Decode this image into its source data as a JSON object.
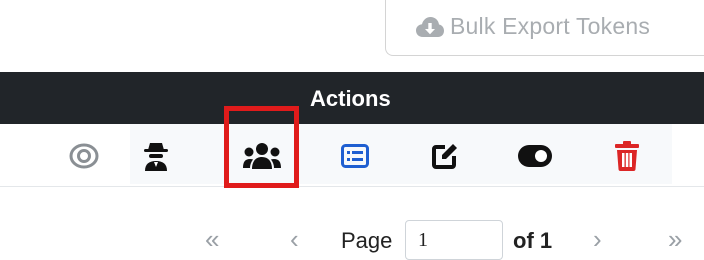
{
  "toolbar": {
    "bulk_export_label": "Bulk Export Tokens",
    "bulk_export_icon": "cloud-download-icon"
  },
  "table": {
    "header": {
      "actions_label": "Actions"
    },
    "row_actions": [
      {
        "name": "view-icon",
        "color": "#8a8f94"
      },
      {
        "name": "impersonate-spy-icon",
        "color": "#111111"
      },
      {
        "name": "users-group-icon",
        "color": "#111111",
        "highlighted": true
      },
      {
        "name": "list-details-icon",
        "color": "#1f5fd1"
      },
      {
        "name": "edit-icon",
        "color": "#111111"
      },
      {
        "name": "toggle-icon",
        "color": "#111111"
      },
      {
        "name": "trash-icon",
        "color": "#dc2626"
      }
    ]
  },
  "pagination": {
    "first_symbol": "«",
    "prev_symbol": "‹",
    "page_label": "Page",
    "page_value": "1",
    "of_label": "of 1",
    "next_symbol": "›",
    "last_symbol": "»"
  },
  "colors": {
    "header_bg": "#212529",
    "highlight_border": "#e01b1b",
    "muted_text": "#a9adb1"
  }
}
